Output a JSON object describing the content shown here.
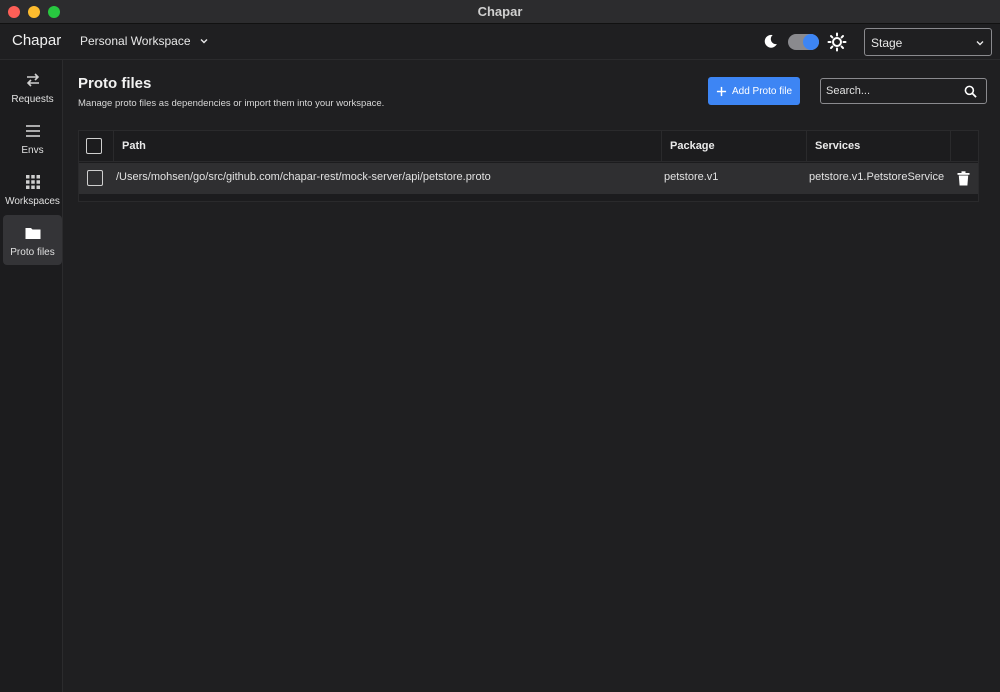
{
  "window": {
    "title": "Chapar"
  },
  "header": {
    "app_name": "Chapar",
    "workspace": "Personal Workspace",
    "environment": "Stage"
  },
  "sidebar": {
    "items": [
      {
        "label": "Requests",
        "icon": "swap-arrows-icon"
      },
      {
        "label": "Envs",
        "icon": "list-lines-icon"
      },
      {
        "label": "Workspaces",
        "icon": "grid-icon"
      },
      {
        "label": "Proto files",
        "icon": "folder-icon",
        "active": true
      }
    ]
  },
  "main": {
    "title": "Proto files",
    "subtitle": "Manage proto files as dependencies or import them into your workspace.",
    "add_button": "Add Proto file",
    "search_placeholder": "Search...",
    "table": {
      "columns": [
        "Path",
        "Package",
        "Services"
      ],
      "rows": [
        {
          "path": "/Users/mohsen/go/src/github.com/chapar-rest/mock-server/api/petstore.proto",
          "package": "petstore.v1",
          "services": "petstore.v1.PetstoreService"
        }
      ]
    }
  },
  "colors": {
    "accent": "#3d85f4",
    "background": "#1f1f21",
    "row_bg": "#2f2f31"
  }
}
